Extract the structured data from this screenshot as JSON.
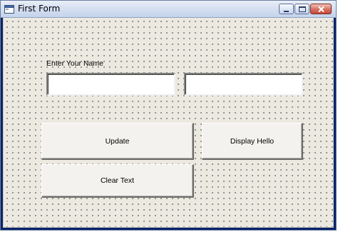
{
  "window": {
    "title": "First Form",
    "icon": "form-window-icon",
    "controls": [
      "minimize-icon",
      "maximize-icon",
      "close-icon"
    ]
  },
  "form": {
    "name_label": "Enter Your Name",
    "name_input": {
      "value": "",
      "placeholder": ""
    },
    "second_input": {
      "value": "",
      "placeholder": ""
    },
    "buttons": {
      "update": "Update",
      "display_hello": "Display Hello",
      "clear_text": "Clear Text"
    }
  },
  "colors": {
    "form_background": "#ece9e0",
    "grid_dot": "#6a6a6a",
    "titlebar": "#d6e0f1",
    "close_button": "#c4493a"
  }
}
